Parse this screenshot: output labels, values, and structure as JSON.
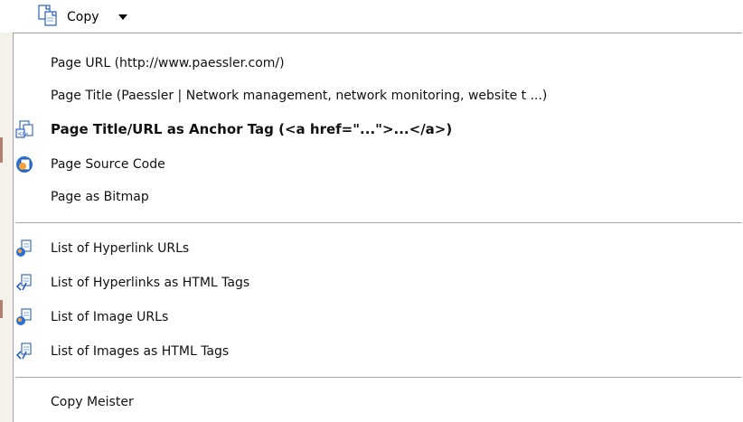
{
  "toolbar": {
    "copy_label": "Copy",
    "copy_icon": "copy-documents-icon",
    "dropdown_icon": "triangle-down-icon"
  },
  "menu": {
    "items": [
      {
        "label": "Page URL (http://www.paessler.com/)",
        "icon": "none",
        "bold": false
      },
      {
        "label": "Page Title (Paessler | Network management, network monitoring, website t ...)",
        "icon": "none",
        "bold": false
      },
      {
        "label": "Page Title/URL as Anchor Tag (<a href=\"...\">...</a>)",
        "icon": "anchor-tag-icon",
        "bold": true
      },
      {
        "label": "Page Source Code",
        "icon": "source-code-icon",
        "bold": false
      },
      {
        "label": "Page as Bitmap",
        "icon": "none",
        "bold": false
      },
      {
        "label": "List of Hyperlink URLs",
        "icon": "hyperlink-list-icon",
        "bold": false
      },
      {
        "label": "List of Hyperlinks as HTML Tags",
        "icon": "html-tags-list-icon",
        "bold": false
      },
      {
        "label": "List of Image URLs",
        "icon": "image-list-icon",
        "bold": false
      },
      {
        "label": "List of Images as HTML Tags",
        "icon": "image-html-tags-icon",
        "bold": false
      },
      {
        "label": "Copy Meister",
        "icon": "none",
        "bold": false
      }
    ]
  },
  "colors": {
    "menu_background": "#ffffff",
    "separator": "#a8a8a8",
    "icon_blue": "#2a6fd6",
    "icon_orange": "#f2a23a"
  }
}
